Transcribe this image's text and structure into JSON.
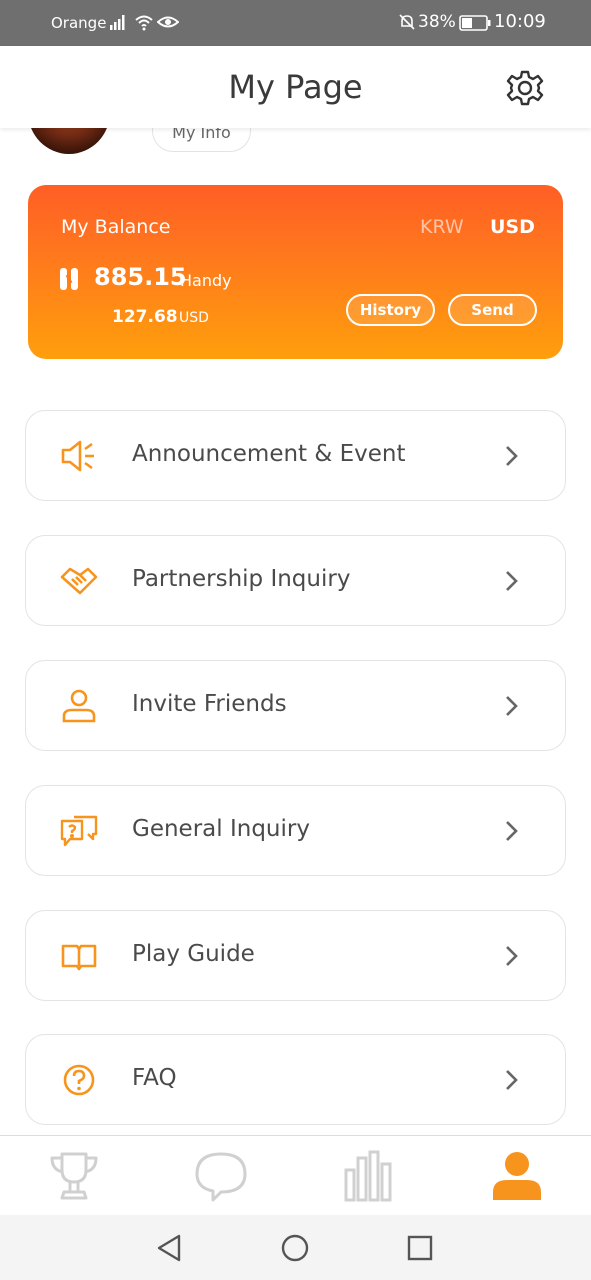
{
  "status_bar": {
    "carrier": "Orange",
    "battery": "38%",
    "time": "10:09"
  },
  "header": {
    "title": "My Page",
    "settings_icon": "gear-icon"
  },
  "profile": {
    "my_info_label": "My Info"
  },
  "balance": {
    "label": "My Balance",
    "currency_krw": "KRW",
    "currency_usd": "USD",
    "selected_currency": "USD",
    "amount": "885.15",
    "unit": "Handy",
    "fiat_amount": "127.68",
    "fiat_unit": "USD",
    "history_label": "History",
    "send_label": "Send"
  },
  "menu": {
    "items": [
      {
        "label": "Announcement & Event",
        "icon": "megaphone-icon"
      },
      {
        "label": "Partnership Inquiry",
        "icon": "handshake-icon"
      },
      {
        "label": "Invite Friends",
        "icon": "person-icon"
      },
      {
        "label": "General Inquiry",
        "icon": "chat-question-icon"
      },
      {
        "label": "Play Guide",
        "icon": "book-icon"
      },
      {
        "label": "FAQ",
        "icon": "question-circle-icon"
      }
    ]
  },
  "tabbar": {
    "tabs": [
      "trophy-icon",
      "chat-bubble-icon",
      "bar-chart-icon",
      "person-icon"
    ],
    "active": "person-icon"
  },
  "colors": {
    "accent": "#f7941d",
    "card_gradient_top": "#ff5e25",
    "card_gradient_bottom": "#ff9f0c",
    "inactive_tab": "#d0d0d0"
  }
}
